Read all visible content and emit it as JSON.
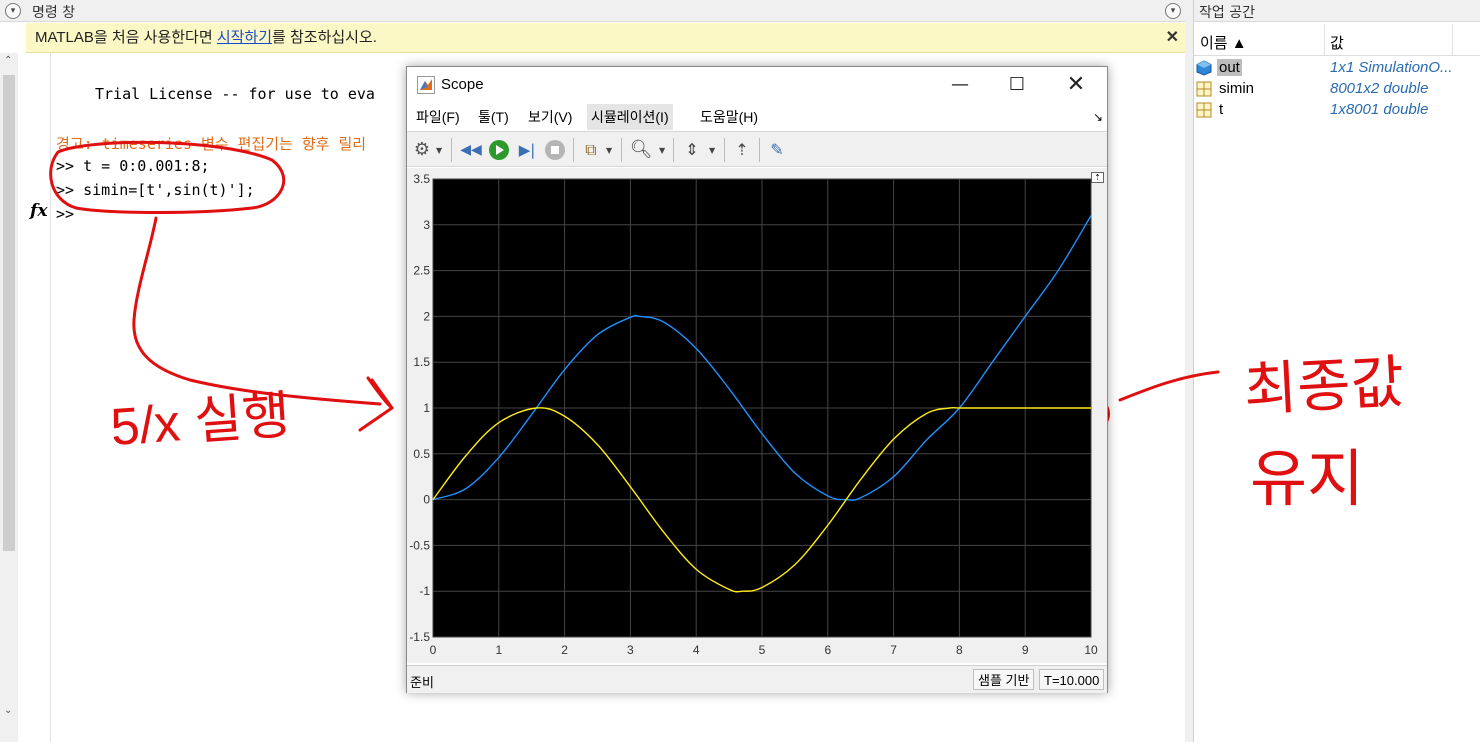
{
  "command_window": {
    "title": "명령 창",
    "notice_pre": "MATLAB을 처음 사용한다면 ",
    "notice_link": "시작하기",
    "notice_post": "를 참조하십시오.",
    "notice_close": "✕",
    "license_line": "Trial License -- for use to eva",
    "warning_line": "경고: timeseries 변수 편집기는 향후 릴리",
    "cmd1": ">> t = 0:0.001:8;",
    "cmd2": ">> simin=[t',sin(t)'];",
    "prompt": ">>",
    "fx": "fx"
  },
  "workspace": {
    "title": "작업 공간",
    "col_name": "이름 ▲",
    "col_value": "값",
    "rows": [
      {
        "name": "out",
        "value": "1x1 SimulationO...",
        "icon": "simulation-output-icon"
      },
      {
        "name": "simin",
        "value": "8001x2 double",
        "icon": "matrix-icon"
      },
      {
        "name": "t",
        "value": "1x8001 double",
        "icon": "matrix-icon"
      }
    ]
  },
  "scope": {
    "title": "Scope",
    "menu": [
      "파일(F)",
      "툴(T)",
      "보기(V)",
      "시뮬레이션(I)",
      "도움말(H)"
    ],
    "status_left": "준비",
    "status_mode": "샘플 기반",
    "status_time": "T=10.000"
  },
  "annotations": {
    "left1": "5/x 실행",
    "right1": "최종값",
    "right2": "유지"
  },
  "colors": {
    "plot_bg": "#000000",
    "series_blue": "#1e90ff",
    "series_yellow": "#ffea1a",
    "annotation": "#e01010",
    "warning": "#e06c1a"
  },
  "chart_data": {
    "type": "line",
    "xlim": [
      0,
      10
    ],
    "ylim": [
      -1.5,
      3.5
    ],
    "xticks": [
      0,
      1,
      2,
      3,
      4,
      5,
      6,
      7,
      8,
      9,
      10
    ],
    "yticks": [
      -1.5,
      -1,
      -0.5,
      0,
      0.5,
      1,
      1.5,
      2,
      2.5,
      3,
      3.5
    ],
    "grid": true,
    "series": [
      {
        "color": "#1e90ff",
        "x": [
          0,
          0.5,
          1,
          1.5,
          2,
          2.5,
          3,
          3.14,
          3.5,
          4,
          4.5,
          5,
          5.5,
          6,
          6.28,
          6.5,
          7,
          7.5,
          8,
          8.5,
          9,
          9.5,
          10
        ],
        "y": [
          0,
          0.12,
          0.46,
          0.93,
          1.42,
          1.8,
          1.99,
          2,
          1.94,
          1.65,
          1.21,
          0.72,
          0.29,
          0.04,
          0,
          0.02,
          0.25,
          0.65,
          1,
          1.5,
          2,
          2.5,
          3.1
        ]
      },
      {
        "color": "#ffea1a",
        "x": [
          0,
          0.5,
          1,
          1.57,
          2,
          2.5,
          3,
          3.5,
          4,
          4.5,
          4.71,
          5,
          5.5,
          6,
          6.5,
          7,
          7.5,
          7.85,
          8,
          8.5,
          9,
          9.5,
          10
        ],
        "y": [
          0,
          0.48,
          0.84,
          1,
          0.91,
          0.6,
          0.14,
          -0.35,
          -0.76,
          -0.98,
          -1,
          -0.96,
          -0.71,
          -0.28,
          0.22,
          0.66,
          0.94,
          1,
          1,
          1,
          1,
          1,
          1
        ]
      }
    ]
  }
}
